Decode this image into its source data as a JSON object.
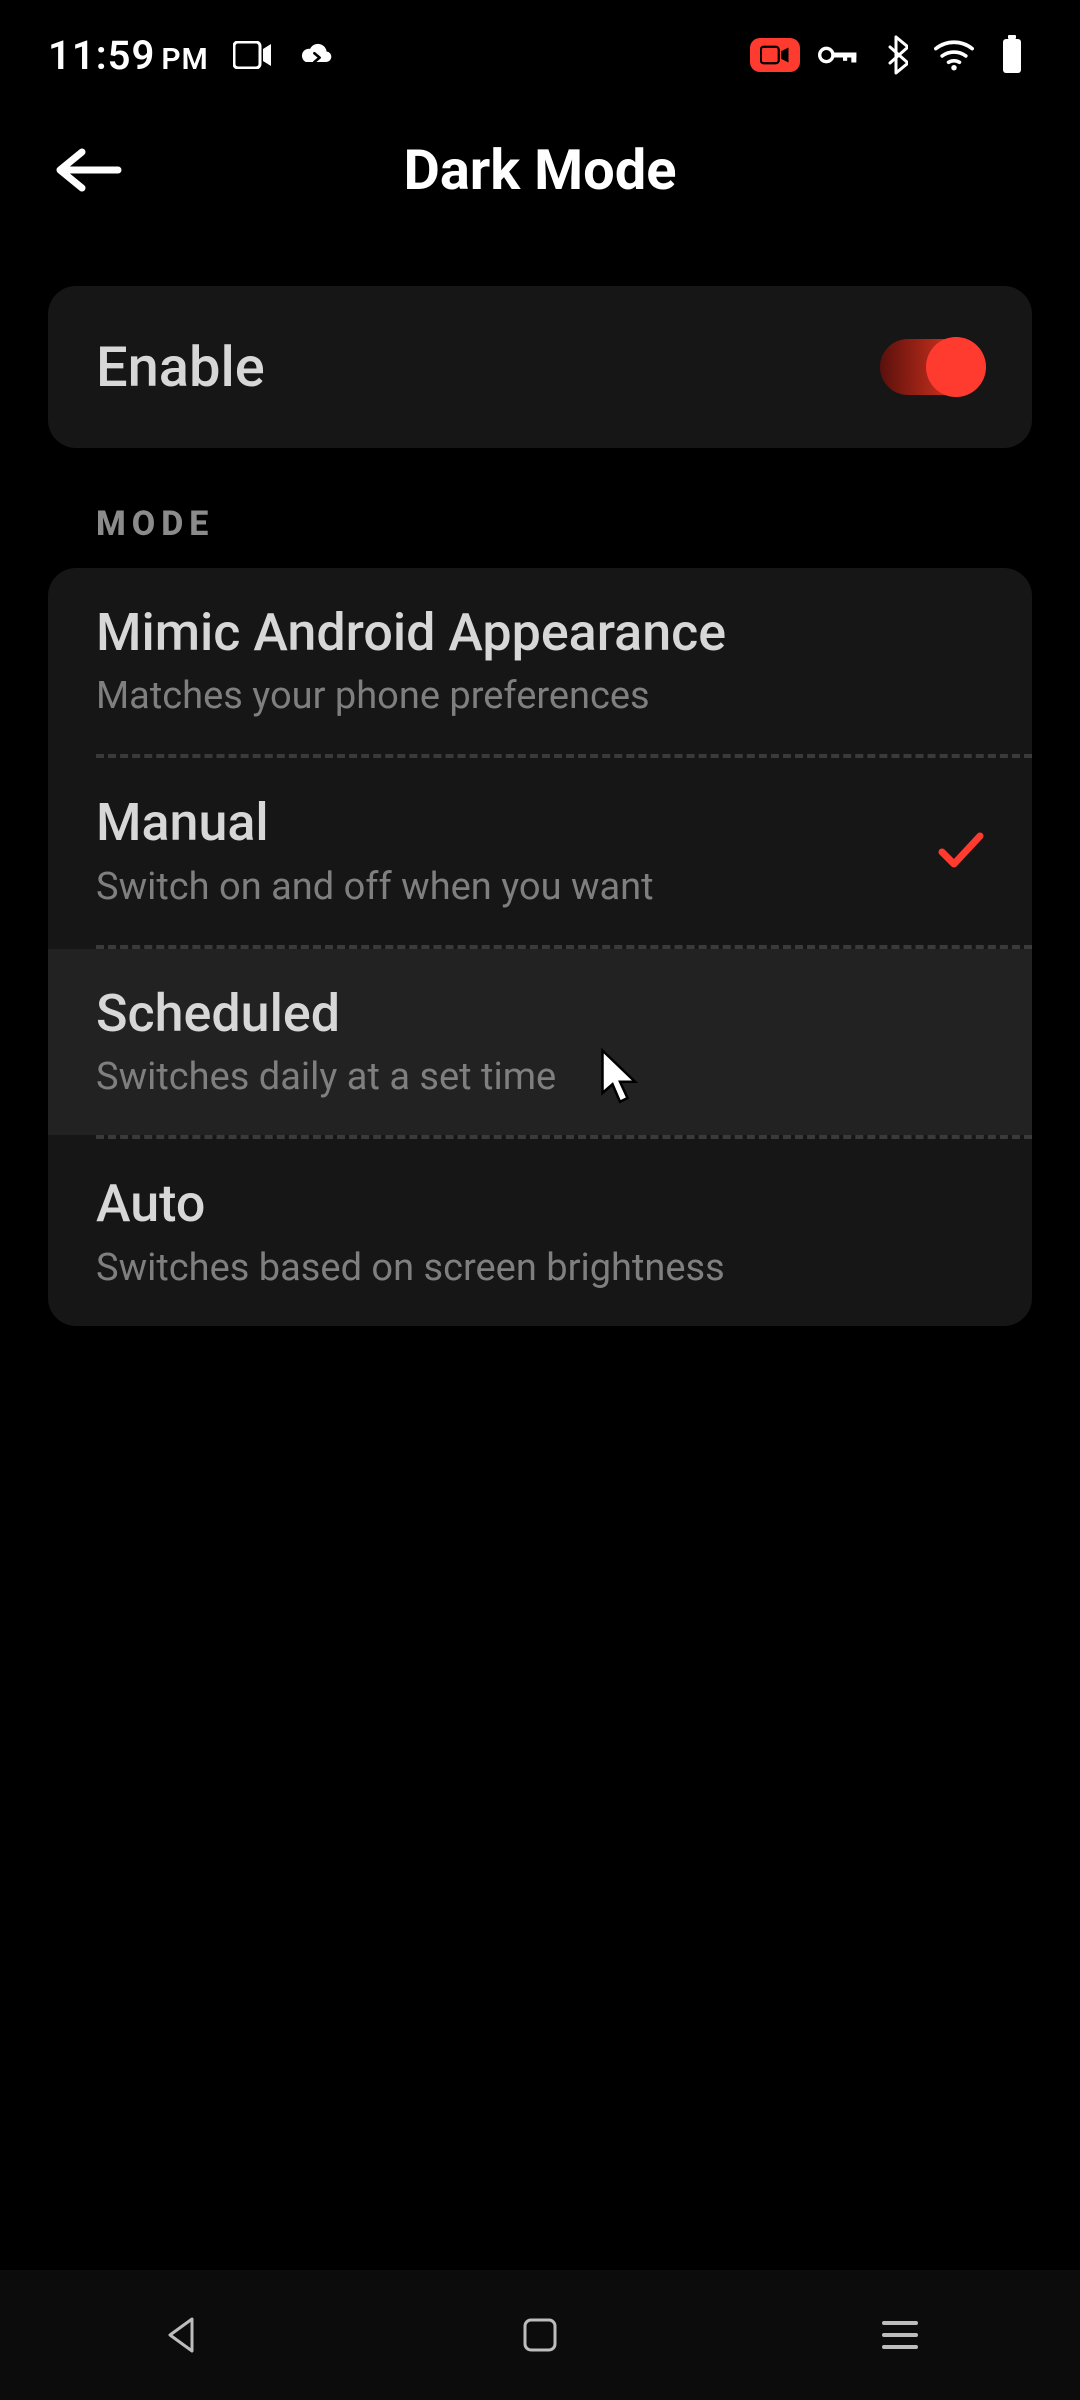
{
  "status": {
    "time": "11:59",
    "ampm": "PM"
  },
  "header": {
    "title": "Dark Mode"
  },
  "enable": {
    "label": "Enable",
    "on": true
  },
  "section_label": "MODE",
  "selected_index": 1,
  "hovered_index": 2,
  "modes": [
    {
      "title": "Mimic Android Appearance",
      "subtitle": "Matches your phone preferences"
    },
    {
      "title": "Manual",
      "subtitle": "Switch on and off when you want"
    },
    {
      "title": "Scheduled",
      "subtitle": "Switches daily at a set time"
    },
    {
      "title": "Auto",
      "subtitle": "Switches based on screen brightness"
    }
  ],
  "colors": {
    "accent": "#ff3b30"
  }
}
